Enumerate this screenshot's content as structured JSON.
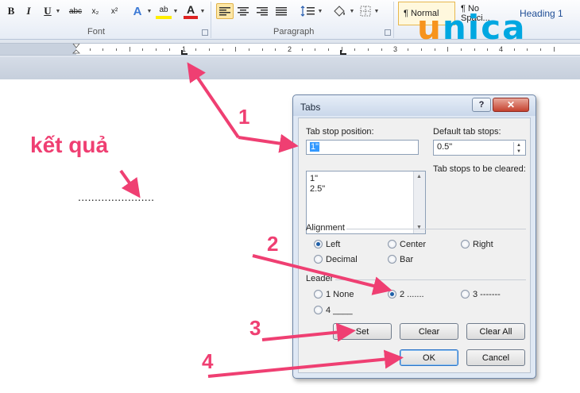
{
  "ribbon": {
    "buttons": {
      "bold": "B",
      "italic": "I",
      "underline": "U",
      "strikethrough": "abc",
      "subscript": "x₂",
      "superscript": "x²",
      "text_effects": "A",
      "highlight": "ab",
      "font_color": "A"
    },
    "groups": {
      "font": "Font",
      "paragraph": "Paragraph"
    },
    "styles": [
      "¶ Normal",
      "¶ No Spaci...",
      "Heading 1"
    ]
  },
  "watermark": {
    "logo_prefix": "u",
    "logo_rest": "nica"
  },
  "ruler": {
    "numbers": [
      "1",
      "2",
      "3",
      "4"
    ]
  },
  "document": {
    "result_label": "kết quả",
    "leader_dots": "......................."
  },
  "dialog": {
    "title": "Tabs",
    "help_label": "?",
    "close_label": "✕",
    "tab_stop_position": {
      "label": "Tab stop position:",
      "value": "1\"",
      "list": [
        "1\"",
        "2.5\""
      ]
    },
    "default_tab_stops": {
      "label": "Default tab stops:",
      "value": "0.5\""
    },
    "tab_stops_to_clear_label": "Tab stops to be cleared:",
    "alignment": {
      "label": "Alignment",
      "options": [
        "Left",
        "Center",
        "Right",
        "Decimal",
        "Bar"
      ],
      "selected": "Left"
    },
    "leader": {
      "label": "Leader",
      "options": [
        "1 None",
        "2 .......",
        "3 -------",
        "4 ____"
      ],
      "selected": "2 ......."
    },
    "buttons": {
      "set": "Set",
      "clear": "Clear",
      "clear_all": "Clear All",
      "ok": "OK",
      "cancel": "Cancel"
    }
  },
  "annotations": {
    "step1": "1",
    "step2": "2",
    "step3": "3",
    "step4": "4"
  },
  "colors": {
    "annotation": "#ef3f72",
    "logo_blue": "#00a7e1",
    "logo_orange": "#f7941d"
  }
}
